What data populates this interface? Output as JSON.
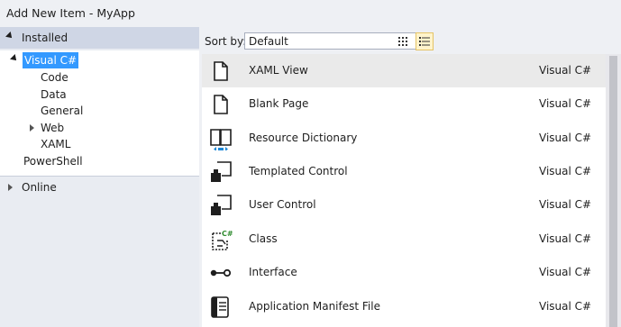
{
  "window": {
    "title": "Add New Item - MyApp"
  },
  "left_panel": {
    "installed_label": "Installed",
    "tree": [
      {
        "label": "Visual C#",
        "selected": true
      },
      {
        "label": "Code"
      },
      {
        "label": "Data"
      },
      {
        "label": "General"
      },
      {
        "label": "Web"
      },
      {
        "label": "XAML"
      },
      {
        "label": "PowerShell"
      }
    ],
    "online_label": "Online"
  },
  "toolbar": {
    "sort_label": "Sort by:",
    "sort_value": "Default",
    "grid_view_icon": "small-icons-view-icon",
    "list_view_icon": "details-view-icon"
  },
  "templates": [
    {
      "name": "XAML View",
      "language": "Visual C#",
      "icon": "document-icon"
    },
    {
      "name": "Blank Page",
      "language": "Visual C#",
      "icon": "document-icon"
    },
    {
      "name": "Resource Dictionary",
      "language": "Visual C#",
      "icon": "book-icon"
    },
    {
      "name": "Templated Control",
      "language": "Visual C#",
      "icon": "control-icon"
    },
    {
      "name": "User Control",
      "language": "Visual C#",
      "icon": "control-icon"
    },
    {
      "name": "Class",
      "language": "Visual C#",
      "icon": "class-icon",
      "badge": "C#"
    },
    {
      "name": "Interface",
      "language": "Visual C#",
      "icon": "interface-icon"
    },
    {
      "name": "Application Manifest File",
      "language": "Visual C#",
      "icon": "manifest-icon"
    }
  ],
  "colors": {
    "selection": "#3399ff",
    "hover_row": "#eaeaea",
    "badge_green": "#2e8b2e",
    "resource_blue": "#1e88d6"
  }
}
